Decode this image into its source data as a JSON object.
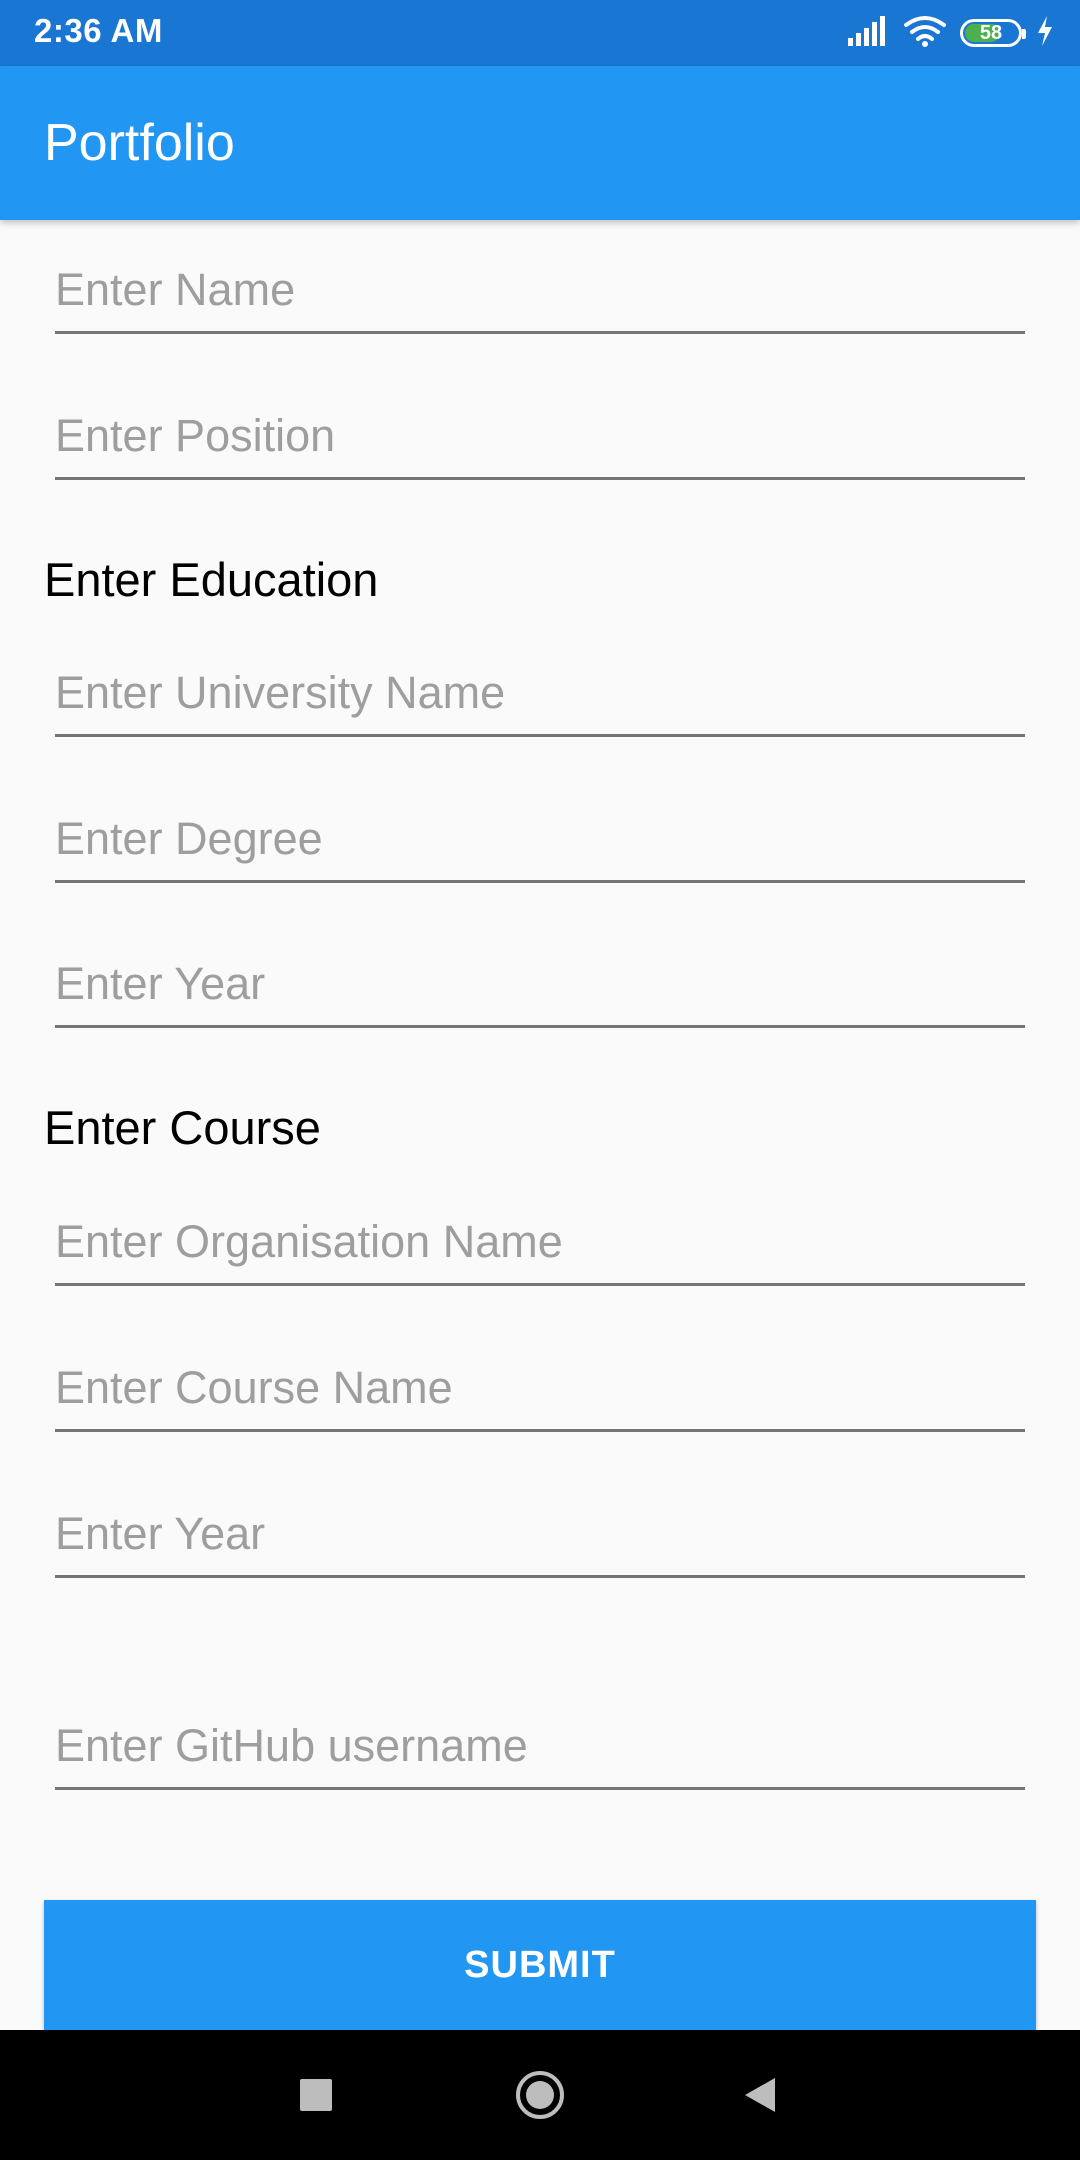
{
  "status_bar": {
    "time": "2:36 AM",
    "battery_level": "58",
    "icons": [
      "signal-icon",
      "wifi-icon",
      "battery-icon",
      "charging-icon"
    ]
  },
  "app_bar": {
    "title": "Portfolio"
  },
  "form": {
    "name_placeholder": "Enter Name",
    "position_placeholder": "Enter Position",
    "education_heading": "Enter Education",
    "university_placeholder": "Enter University Name",
    "degree_placeholder": "Enter Degree",
    "education_year_placeholder": "Enter Year",
    "course_heading": "Enter Course",
    "organisation_placeholder": "Enter Organisation Name",
    "course_name_placeholder": "Enter Course Name",
    "course_year_placeholder": "Enter Year",
    "github_placeholder": "Enter GitHub username",
    "submit_label": "SUBMIT"
  },
  "nav_bar": {
    "icons": [
      "recents-icon",
      "home-icon",
      "back-icon"
    ]
  },
  "colors": {
    "status_bar": "#1976d2",
    "app_bar": "#2196f3",
    "button": "#2196f3",
    "background": "#fafafa",
    "battery_fill": "#4caf50"
  }
}
